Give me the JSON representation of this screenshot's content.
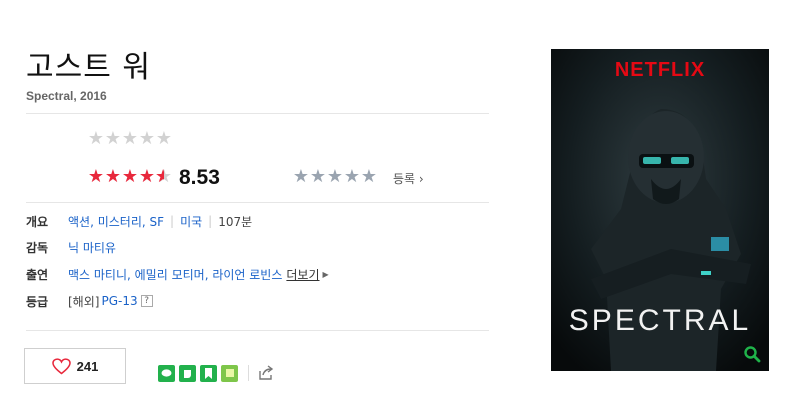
{
  "movie": {
    "title": "고스트 워",
    "subtitle": "Spectral, 2016"
  },
  "rating": {
    "user_rating_stars": 0,
    "netizen_stars": 4.5,
    "netizen_score": "8.53",
    "critic_stars": 0,
    "register_label": "등록",
    "register_icon": "chevron-right-icon"
  },
  "info": {
    "overview_label": "개요",
    "genres": "액션, 미스터리, SF",
    "country": "미국",
    "runtime": "107분",
    "director_label": "감독",
    "director": "닉 마티유",
    "cast_label": "출연",
    "cast": "맥스 마티니, 에밀리 모티머, 라이언 로빈스",
    "more_label": "더보기",
    "grade_label": "등급",
    "grade_region": "[해외]",
    "grade": "PG-13",
    "help_mark": "?"
  },
  "actions": {
    "like_count": "241",
    "like_icon": "heart-icon",
    "share_icons": [
      "line-icon",
      "band-icon",
      "bookmark-icon",
      "memo-icon",
      "share-icon"
    ]
  },
  "poster": {
    "brand": "NETFLIX",
    "title": "SPECTRAL",
    "zoom_icon": "magnifier-icon"
  },
  "colors": {
    "star_on": "#e8283c",
    "star_off": "#d2d2d2",
    "link": "#1a62c8",
    "netflix_red": "#e50914",
    "green": "#22b14c"
  }
}
